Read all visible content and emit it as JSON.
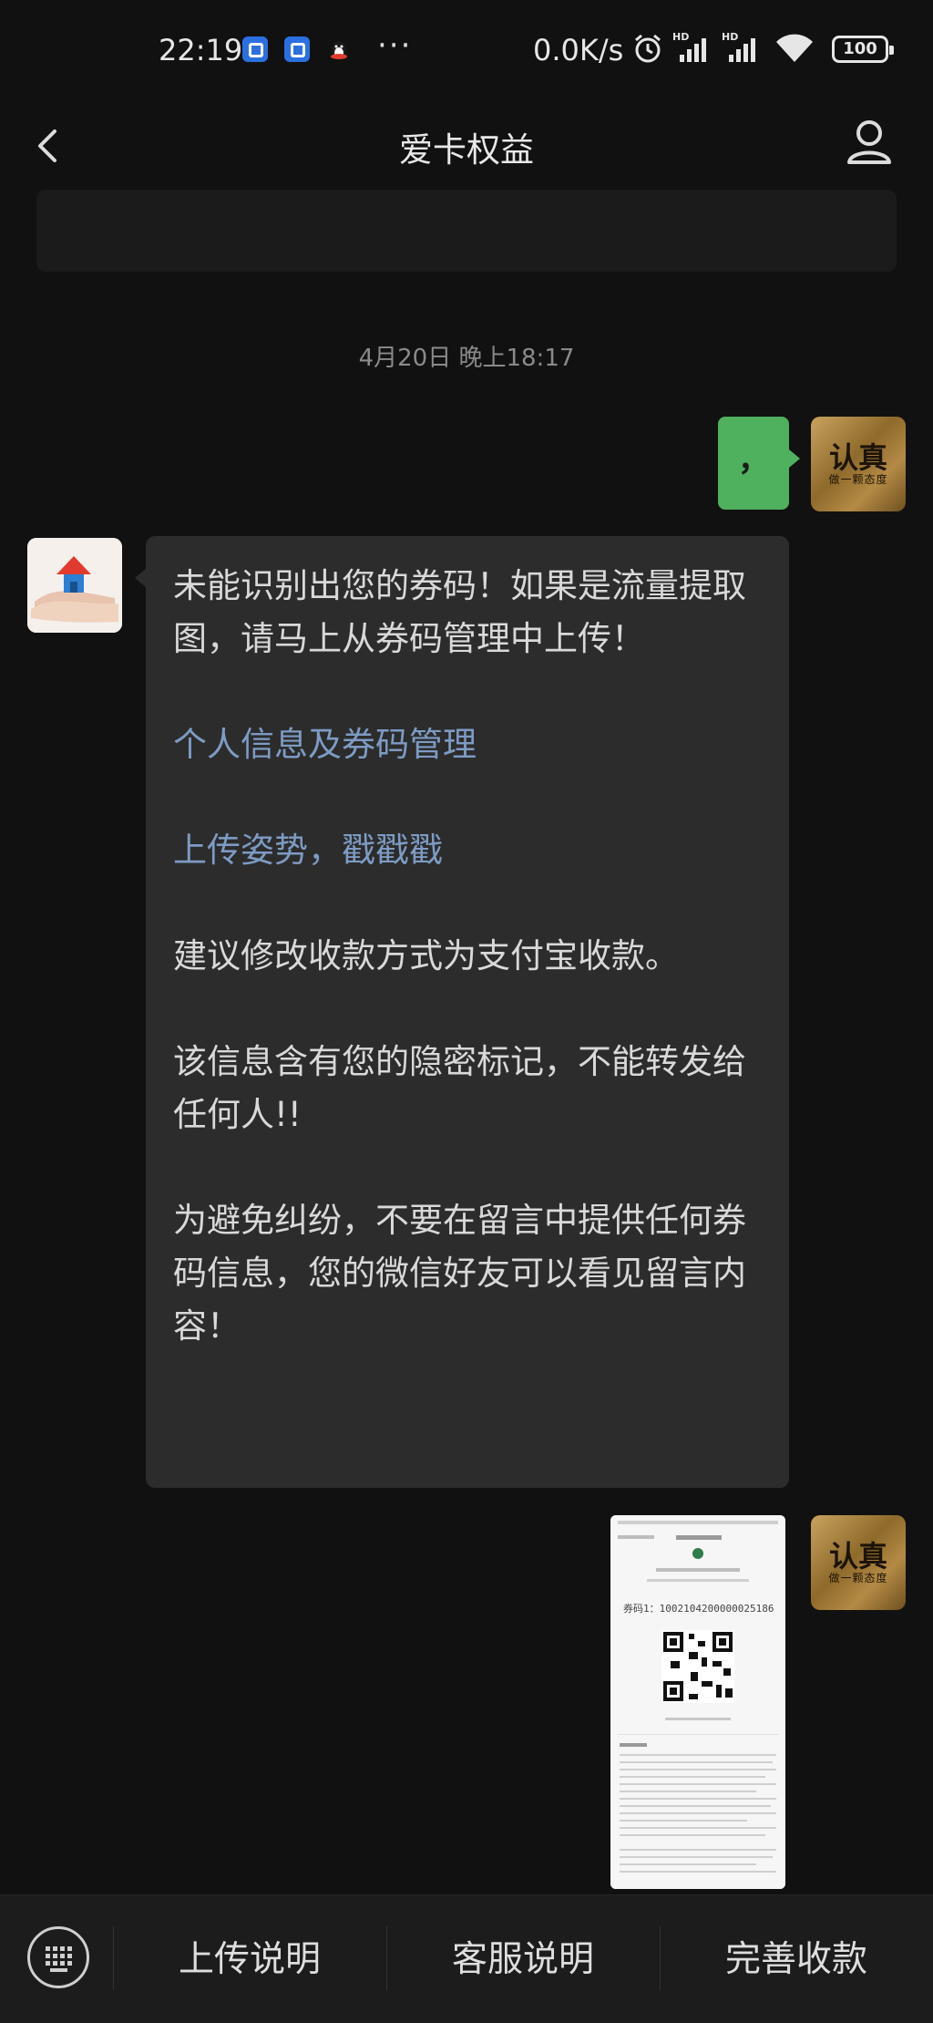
{
  "status_bar": {
    "time": "22:19",
    "dots": "···",
    "network_speed": "0.0K/s",
    "signal_label": "HD",
    "battery": "100"
  },
  "nav": {
    "title": "爱卡权益"
  },
  "chat": {
    "timestamp": "4月20日 晚上18:17",
    "user_text": "，",
    "user_avatar_text": "认真",
    "user_avatar_sub": "做一颗态度",
    "bot_message": {
      "line1": "未能识别出您的券码！如果是流量提取图，请马上从券码管理中上传！",
      "link1": "个人信息及券码管理",
      "link2": "上传姿势，戳戳戳",
      "line2": "建议修改收款方式为支付宝收款。",
      "line3": "该信息含有您的隐密标记，不能转发给任何人!!",
      "line4": "为避免纠纷，不要在留言中提供任何券码信息，您的微信好友可以看见留言内容！"
    },
    "image_message": {
      "code_text": "券码1：1002104200000025186"
    }
  },
  "bottom_menu": {
    "item1": "上传说明",
    "item2": "客服说明",
    "item3": "完善收款"
  },
  "colors": {
    "background": "#111111",
    "green_bubble": "#4fb05e",
    "gray_bubble": "#2c2c2c",
    "link": "#7d9bc4"
  }
}
